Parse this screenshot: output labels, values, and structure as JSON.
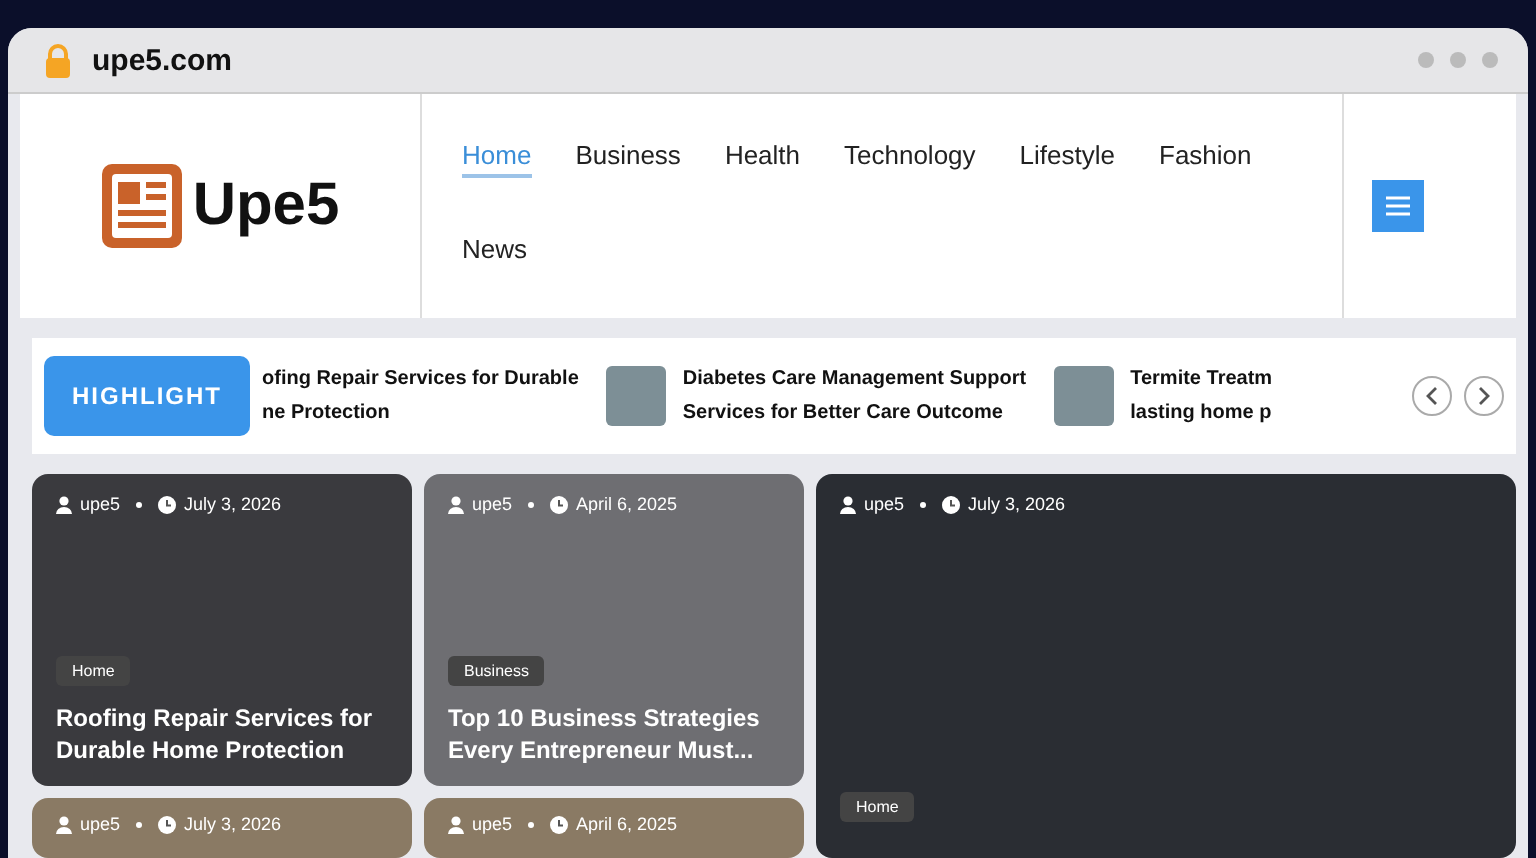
{
  "browser": {
    "url": "upe5.com"
  },
  "header": {
    "logo": "Upe5",
    "nav": [
      {
        "label": "Home",
        "selected": true
      },
      {
        "label": "Business",
        "selected": false
      },
      {
        "label": "Health",
        "selected": false
      },
      {
        "label": "Technology",
        "selected": false
      },
      {
        "label": "Lifestyle",
        "selected": false
      },
      {
        "label": "Fashion",
        "selected": false
      },
      {
        "label": "News",
        "selected": false
      }
    ]
  },
  "ticker": {
    "label": "HIGHLIGHT",
    "items": [
      {
        "lines": [
          "ofing Repair Services for Durable",
          "ne Protection"
        ],
        "thumbnail": false
      },
      {
        "lines": [
          "Diabetes Care Management Support",
          "Services for Better Care Outcome"
        ],
        "thumbnail": true
      },
      {
        "lines": [
          "Termite Treatm",
          "lasting home p"
        ],
        "thumbnail": true
      }
    ]
  },
  "cards": [
    {
      "kind": "small",
      "author": "upe5",
      "date": "July 3, 2026",
      "category": "Home",
      "title": "Roofing Repair Services for Durable Home Protection"
    },
    {
      "kind": "small",
      "author": "upe5",
      "date": "April 6, 2025",
      "category": "Business",
      "title": "Top 10 Business Strategies Every Entrepreneur Must..."
    },
    {
      "kind": "large",
      "author": "upe5",
      "date": "July 3, 2026",
      "category": "Home"
    },
    {
      "kind": "partial",
      "author": "upe5",
      "date": "July 3, 2026"
    },
    {
      "kind": "partial",
      "author": "upe5",
      "date": "April 6, 2025"
    }
  ]
}
